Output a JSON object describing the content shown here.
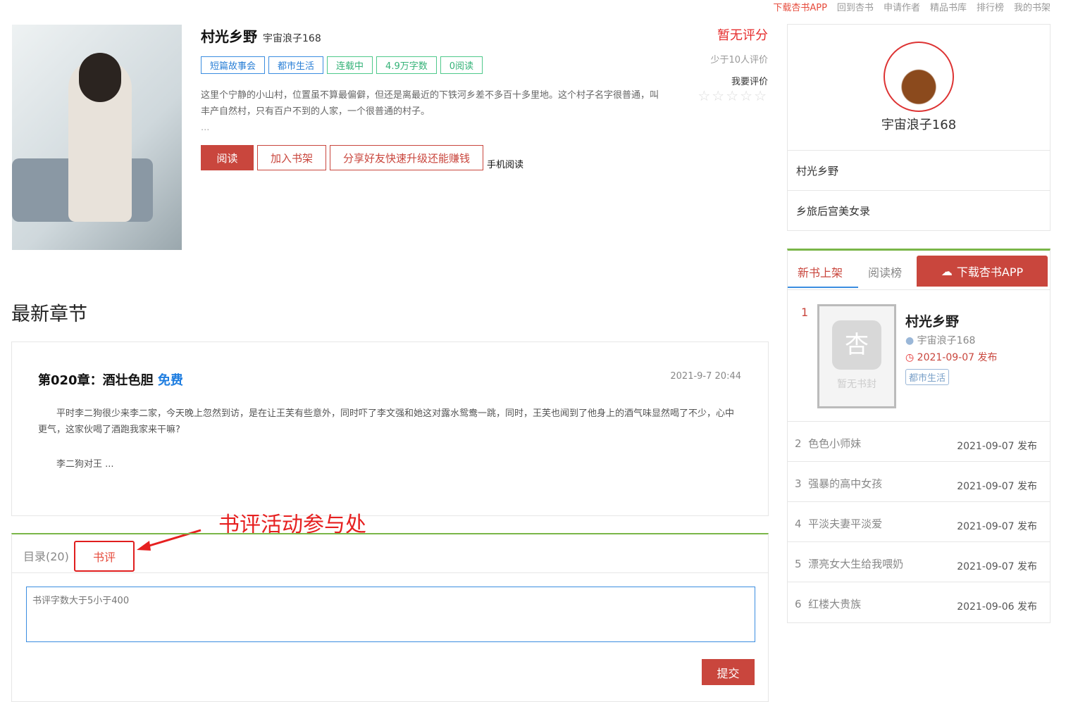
{
  "topnav": [
    "下载杏书APP",
    "回到杏书",
    "申请作者",
    "精品书库",
    "排行榜",
    "我的书架"
  ],
  "book": {
    "title": "村光乡野",
    "author": "宇宙浪子168",
    "tags": [
      "短篇故事会",
      "都市生活",
      "连载中",
      "4.9万字数",
      "0阅读"
    ],
    "desc": "这里个宁静的小山村，位置虽不算最偏僻，但还是离最近的下铁河乡差不多百十多里地。这个村子名字很普通，叫丰产自然村，只有百户不到的人家，一个很普通的村子。",
    "ellipsis": "...",
    "buttons": {
      "read": "阅读",
      "shelf": "加入书架",
      "share": "分享好友快速升级还能赚钱",
      "mobile": "手机阅读"
    }
  },
  "rating": {
    "score": "暂无评分",
    "count": "少于10人评价",
    "rate": "我要评价",
    "stars": "☆☆☆☆☆",
    "value": 0
  },
  "author_box": {
    "name": "宇宙浪子168",
    "books": [
      "村光乡野",
      "乡旅后宫美女录"
    ]
  },
  "latest": {
    "heading": "最新章节",
    "chapter": "第020章：酒壮色胆",
    "free": "免费",
    "time": "2021-9-7 20:44",
    "para1": "平时李二狗很少来李二家，今天晚上忽然到访，是在让王芙有些意外，同时吓了李文强和她这对露水鸳鸯一跳，同时，王芙也闻到了他身上的酒气味显然喝了不少，心中更气，这家伙喝了酒跑我家来干嘛?",
    "para2": "李二狗对王 ..."
  },
  "annotation": "书评活动参与处",
  "review": {
    "tab_toc": "目录(20)",
    "tab_review": "书评",
    "placeholder": "书评字数大于5小于400",
    "submit": "提交"
  },
  "ranking": {
    "tab_new": "新书上架",
    "tab_read": "阅读榜",
    "download": "下载杏书APP",
    "first": {
      "rank": "1",
      "title": "村光乡野",
      "author": "宇宙浪子168",
      "date": "2021-09-07 发布",
      "tag": "都市生活",
      "nocover": "暂无书封"
    },
    "items": [
      {
        "rank": "2",
        "title": "色色小师妹",
        "date": "2021-09-07 发布"
      },
      {
        "rank": "3",
        "title": "强暴的高中女孩",
        "date": "2021-09-07 发布"
      },
      {
        "rank": "4",
        "title": "平淡夫妻平淡爱",
        "date": "2021-09-07 发布"
      },
      {
        "rank": "5",
        "title": "漂亮女大生给我喂奶",
        "date": "2021-09-07 发布"
      },
      {
        "rank": "6",
        "title": "红楼大贵族",
        "date": "2021-09-06 发布"
      }
    ]
  },
  "colors": {
    "accent": "#c9463d",
    "green": "#7ab648",
    "blue": "#3b8de0"
  }
}
